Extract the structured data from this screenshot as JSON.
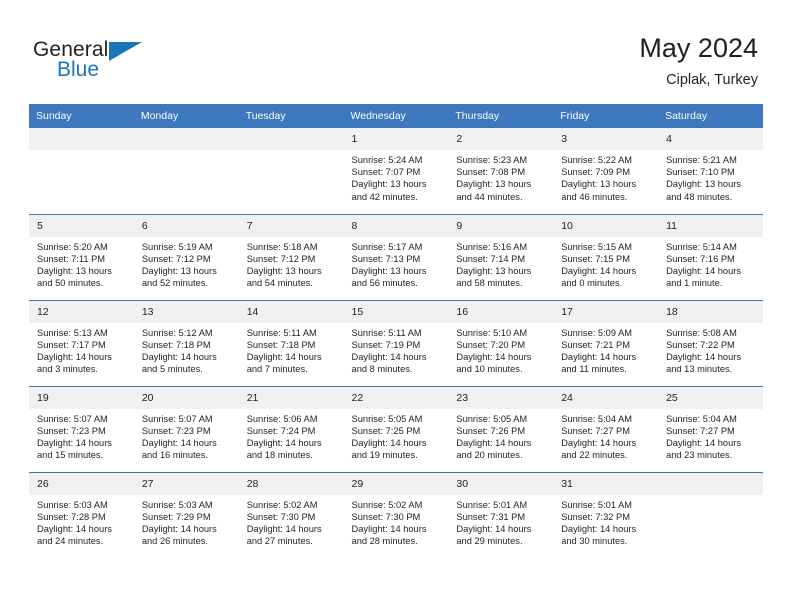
{
  "brand": {
    "name_part1": "General",
    "name_part2": "Blue",
    "accent_color": "#1b75bb"
  },
  "header": {
    "title": "May 2024",
    "subtitle": "Ciplak, Turkey",
    "header_bg_color": "#3d78bf",
    "daynum_bg_color": "#f0f0f0"
  },
  "weekdays": [
    "Sunday",
    "Monday",
    "Tuesday",
    "Wednesday",
    "Thursday",
    "Friday",
    "Saturday"
  ],
  "weeks": [
    [
      {
        "day": "",
        "empty": true
      },
      {
        "day": "",
        "empty": true
      },
      {
        "day": "",
        "empty": true
      },
      {
        "day": "1",
        "sunrise": "Sunrise: 5:24 AM",
        "sunset": "Sunset: 7:07 PM",
        "daylight1": "Daylight: 13 hours",
        "daylight2": "and 42 minutes."
      },
      {
        "day": "2",
        "sunrise": "Sunrise: 5:23 AM",
        "sunset": "Sunset: 7:08 PM",
        "daylight1": "Daylight: 13 hours",
        "daylight2": "and 44 minutes."
      },
      {
        "day": "3",
        "sunrise": "Sunrise: 5:22 AM",
        "sunset": "Sunset: 7:09 PM",
        "daylight1": "Daylight: 13 hours",
        "daylight2": "and 46 minutes."
      },
      {
        "day": "4",
        "sunrise": "Sunrise: 5:21 AM",
        "sunset": "Sunset: 7:10 PM",
        "daylight1": "Daylight: 13 hours",
        "daylight2": "and 48 minutes."
      }
    ],
    [
      {
        "day": "5",
        "sunrise": "Sunrise: 5:20 AM",
        "sunset": "Sunset: 7:11 PM",
        "daylight1": "Daylight: 13 hours",
        "daylight2": "and 50 minutes."
      },
      {
        "day": "6",
        "sunrise": "Sunrise: 5:19 AM",
        "sunset": "Sunset: 7:12 PM",
        "daylight1": "Daylight: 13 hours",
        "daylight2": "and 52 minutes."
      },
      {
        "day": "7",
        "sunrise": "Sunrise: 5:18 AM",
        "sunset": "Sunset: 7:12 PM",
        "daylight1": "Daylight: 13 hours",
        "daylight2": "and 54 minutes."
      },
      {
        "day": "8",
        "sunrise": "Sunrise: 5:17 AM",
        "sunset": "Sunset: 7:13 PM",
        "daylight1": "Daylight: 13 hours",
        "daylight2": "and 56 minutes."
      },
      {
        "day": "9",
        "sunrise": "Sunrise: 5:16 AM",
        "sunset": "Sunset: 7:14 PM",
        "daylight1": "Daylight: 13 hours",
        "daylight2": "and 58 minutes."
      },
      {
        "day": "10",
        "sunrise": "Sunrise: 5:15 AM",
        "sunset": "Sunset: 7:15 PM",
        "daylight1": "Daylight: 14 hours",
        "daylight2": "and 0 minutes."
      },
      {
        "day": "11",
        "sunrise": "Sunrise: 5:14 AM",
        "sunset": "Sunset: 7:16 PM",
        "daylight1": "Daylight: 14 hours",
        "daylight2": "and 1 minute."
      }
    ],
    [
      {
        "day": "12",
        "sunrise": "Sunrise: 5:13 AM",
        "sunset": "Sunset: 7:17 PM",
        "daylight1": "Daylight: 14 hours",
        "daylight2": "and 3 minutes."
      },
      {
        "day": "13",
        "sunrise": "Sunrise: 5:12 AM",
        "sunset": "Sunset: 7:18 PM",
        "daylight1": "Daylight: 14 hours",
        "daylight2": "and 5 minutes."
      },
      {
        "day": "14",
        "sunrise": "Sunrise: 5:11 AM",
        "sunset": "Sunset: 7:18 PM",
        "daylight1": "Daylight: 14 hours",
        "daylight2": "and 7 minutes."
      },
      {
        "day": "15",
        "sunrise": "Sunrise: 5:11 AM",
        "sunset": "Sunset: 7:19 PM",
        "daylight1": "Daylight: 14 hours",
        "daylight2": "and 8 minutes."
      },
      {
        "day": "16",
        "sunrise": "Sunrise: 5:10 AM",
        "sunset": "Sunset: 7:20 PM",
        "daylight1": "Daylight: 14 hours",
        "daylight2": "and 10 minutes."
      },
      {
        "day": "17",
        "sunrise": "Sunrise: 5:09 AM",
        "sunset": "Sunset: 7:21 PM",
        "daylight1": "Daylight: 14 hours",
        "daylight2": "and 11 minutes."
      },
      {
        "day": "18",
        "sunrise": "Sunrise: 5:08 AM",
        "sunset": "Sunset: 7:22 PM",
        "daylight1": "Daylight: 14 hours",
        "daylight2": "and 13 minutes."
      }
    ],
    [
      {
        "day": "19",
        "sunrise": "Sunrise: 5:07 AM",
        "sunset": "Sunset: 7:23 PM",
        "daylight1": "Daylight: 14 hours",
        "daylight2": "and 15 minutes."
      },
      {
        "day": "20",
        "sunrise": "Sunrise: 5:07 AM",
        "sunset": "Sunset: 7:23 PM",
        "daylight1": "Daylight: 14 hours",
        "daylight2": "and 16 minutes."
      },
      {
        "day": "21",
        "sunrise": "Sunrise: 5:06 AM",
        "sunset": "Sunset: 7:24 PM",
        "daylight1": "Daylight: 14 hours",
        "daylight2": "and 18 minutes."
      },
      {
        "day": "22",
        "sunrise": "Sunrise: 5:05 AM",
        "sunset": "Sunset: 7:25 PM",
        "daylight1": "Daylight: 14 hours",
        "daylight2": "and 19 minutes."
      },
      {
        "day": "23",
        "sunrise": "Sunrise: 5:05 AM",
        "sunset": "Sunset: 7:26 PM",
        "daylight1": "Daylight: 14 hours",
        "daylight2": "and 20 minutes."
      },
      {
        "day": "24",
        "sunrise": "Sunrise: 5:04 AM",
        "sunset": "Sunset: 7:27 PM",
        "daylight1": "Daylight: 14 hours",
        "daylight2": "and 22 minutes."
      },
      {
        "day": "25",
        "sunrise": "Sunrise: 5:04 AM",
        "sunset": "Sunset: 7:27 PM",
        "daylight1": "Daylight: 14 hours",
        "daylight2": "and 23 minutes."
      }
    ],
    [
      {
        "day": "26",
        "sunrise": "Sunrise: 5:03 AM",
        "sunset": "Sunset: 7:28 PM",
        "daylight1": "Daylight: 14 hours",
        "daylight2": "and 24 minutes."
      },
      {
        "day": "27",
        "sunrise": "Sunrise: 5:03 AM",
        "sunset": "Sunset: 7:29 PM",
        "daylight1": "Daylight: 14 hours",
        "daylight2": "and 26 minutes."
      },
      {
        "day": "28",
        "sunrise": "Sunrise: 5:02 AM",
        "sunset": "Sunset: 7:30 PM",
        "daylight1": "Daylight: 14 hours",
        "daylight2": "and 27 minutes."
      },
      {
        "day": "29",
        "sunrise": "Sunrise: 5:02 AM",
        "sunset": "Sunset: 7:30 PM",
        "daylight1": "Daylight: 14 hours",
        "daylight2": "and 28 minutes."
      },
      {
        "day": "30",
        "sunrise": "Sunrise: 5:01 AM",
        "sunset": "Sunset: 7:31 PM",
        "daylight1": "Daylight: 14 hours",
        "daylight2": "and 29 minutes."
      },
      {
        "day": "31",
        "sunrise": "Sunrise: 5:01 AM",
        "sunset": "Sunset: 7:32 PM",
        "daylight1": "Daylight: 14 hours",
        "daylight2": "and 30 minutes."
      },
      {
        "day": "",
        "empty": true
      }
    ]
  ]
}
